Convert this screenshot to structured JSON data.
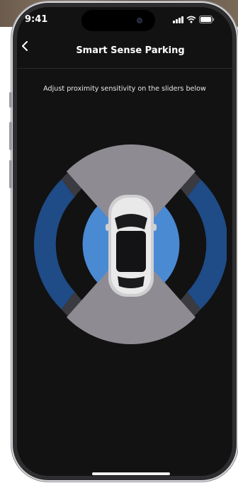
{
  "status_bar": {
    "time": "9:41"
  },
  "header": {
    "title": "Smart Sense Parking"
  },
  "instruction": "Adjust proximity sensitivity on the sliders below",
  "colors": {
    "outer_blue": "#1f4b86",
    "inner_blue": "#4a8ad3",
    "outer_gray": "#3a3a40",
    "inner_gray": "#8e8b93",
    "screen_bg": "#121212"
  },
  "icons": {
    "back": "chevron-left-icon",
    "signal": "cellular-signal-icon",
    "wifi": "wifi-icon",
    "battery": "battery-icon",
    "car": "car-top-view-icon"
  }
}
